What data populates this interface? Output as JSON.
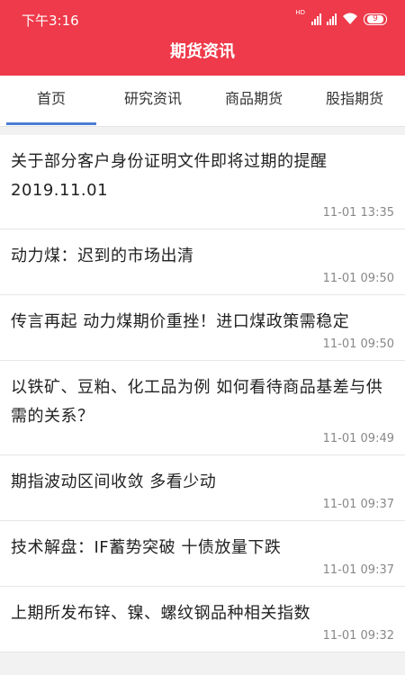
{
  "status_bar": {
    "time": "下午3:16",
    "network_label": "HD",
    "battery_level": "9"
  },
  "app_bar": {
    "title": "期货资讯"
  },
  "tabs": [
    {
      "label": "首页",
      "selected": true
    },
    {
      "label": "研究资讯",
      "selected": false
    },
    {
      "label": "商品期货",
      "selected": false
    },
    {
      "label": "股指期货",
      "selected": false
    }
  ],
  "news": [
    {
      "title": "关于部分客户身份证明文件即将过期的提醒2019.11.01",
      "time": "11-01 13:35"
    },
    {
      "title": "动力煤：迟到的市场出清",
      "time": "11-01 09:50"
    },
    {
      "title": "传言再起 动力煤期价重挫！进口煤政策需稳定",
      "time": "11-01 09:50"
    },
    {
      "title": "以铁矿、豆粕、化工品为例 如何看待商品基差与供需的关系？",
      "time": "11-01 09:49"
    },
    {
      "title": "期指波动区间收敛 多看少动",
      "time": "11-01 09:37"
    },
    {
      "title": "技术解盘：IF蓄势突破 十债放量下跌",
      "time": "11-01 09:37"
    },
    {
      "title": "上期所发布锌、镍、螺纹钢品种相关指数",
      "time": "11-01 09:32"
    }
  ],
  "colors": {
    "brand_red": "#ee3a4a",
    "tab_indicator": "#4a7fd4"
  }
}
